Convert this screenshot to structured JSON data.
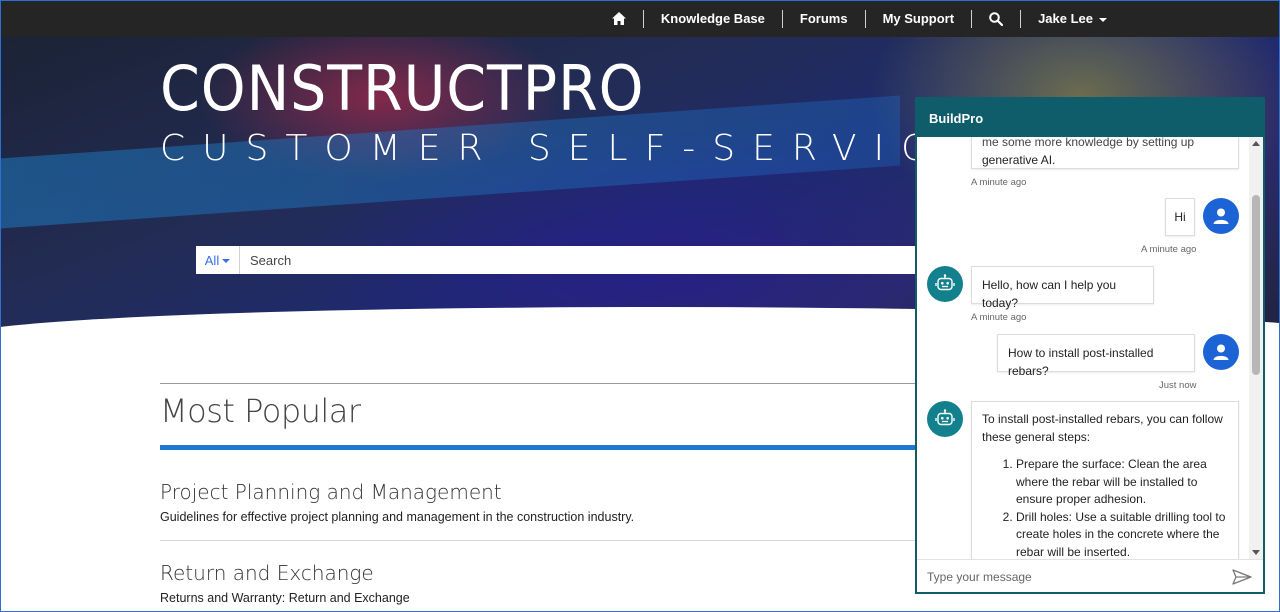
{
  "nav": {
    "items": [
      "Knowledge Base",
      "Forums",
      "My Support"
    ],
    "user_name": "Jake Lee",
    "icons": [
      "home-icon",
      "search-icon"
    ]
  },
  "hero": {
    "title": "CONSTRUCTPRO",
    "subtitle": "CUSTOMER SELF-SERVICE"
  },
  "search": {
    "filter_label": "All",
    "placeholder": "Search"
  },
  "main": {
    "section_title": "Most Popular",
    "articles": [
      {
        "title": "Project Planning and Management",
        "description": "Guidelines for effective project planning and management in the construction industry."
      },
      {
        "title": "Return and Exchange",
        "description": "Returns and Warranty: Return and Exchange"
      }
    ]
  },
  "chat": {
    "title": "BuildPro",
    "messages": [
      {
        "sender": "bot",
        "text_lines": [
          "me some more knowledge by setting up",
          "generative AI."
        ],
        "time": "A minute ago"
      },
      {
        "sender": "user",
        "text": "Hi",
        "time": "A minute ago"
      },
      {
        "sender": "bot",
        "text": "Hello, how can I help you today?",
        "time": "A minute ago"
      },
      {
        "sender": "user",
        "text": "How to install post-installed rebars?",
        "time": "Just now"
      },
      {
        "sender": "bot",
        "intro": "To install post-installed rebars, you can follow these general steps:",
        "steps": [
          "Prepare the surface: Clean the area where the rebar will be installed to ensure proper adhesion.",
          "Drill holes: Use a suitable drilling tool to create holes in the concrete where the rebar will be inserted."
        ]
      }
    ],
    "input_placeholder": "Type your message",
    "colors": {
      "header": "#0f5c6b",
      "user_avatar": "#1c63d6",
      "bot_avatar": "#13818d"
    }
  }
}
